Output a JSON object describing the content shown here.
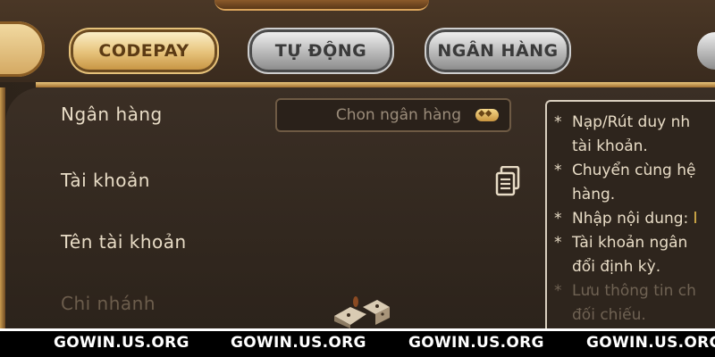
{
  "tabs": {
    "codepay": "CODEPAY",
    "auto": "TỰ ĐỘNG",
    "bank": "NGÂN HÀNG"
  },
  "form": {
    "bank_label": "Ngân hàng",
    "bank_select_placeholder": "Chon ngân hàng",
    "account_label": "Tài khoản",
    "account_name_label": "Tên tài khoản",
    "branch_label": "Chi nhánh"
  },
  "notes": [
    {
      "text": "Nạp/Rút duy nh"
    },
    {
      "text": "tài khoản."
    },
    {
      "text": "Chuyển cùng hệ"
    },
    {
      "text": "hàng."
    },
    {
      "text": "Nhập nội dung: ",
      "highlight": "l"
    },
    {
      "text": "Tài khoản ngân"
    },
    {
      "text": "đổi định kỳ."
    },
    {
      "text": "Lưu thông tin ch"
    },
    {
      "text": "đối chiếu."
    }
  ],
  "footer": {
    "watermark_1": "GOWIN.US.ORG",
    "watermark_2": "GOWIN.US.ORG",
    "watermark_3": "GOWIN.US.ORG",
    "watermark_4": "GOWIN.US.ORG"
  },
  "colors": {
    "gold": "#e6c27a",
    "panel": "#2e241b",
    "text": "#e8dcc6"
  },
  "icons": {
    "select": "heart-gem-icon",
    "copy": "copy-document-icon",
    "decoration": "dice-icon"
  }
}
